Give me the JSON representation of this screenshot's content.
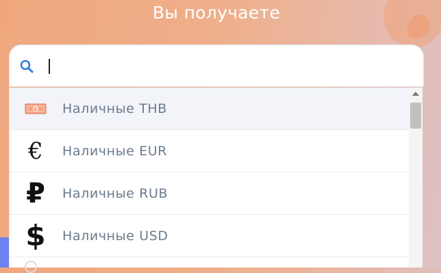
{
  "header": {
    "title": "Вы получаете"
  },
  "search": {
    "value": "",
    "placeholder": ""
  },
  "options": [
    {
      "label": "Наличные THB",
      "icon": "baht-banknote-icon",
      "glyph": "฿",
      "highlighted": true
    },
    {
      "label": "Наличные EUR",
      "icon": "euro-icon",
      "glyph": "€",
      "highlighted": false
    },
    {
      "label": "Наличные RUB",
      "icon": "ruble-icon",
      "glyph": "₽",
      "highlighted": false
    },
    {
      "label": "Наличные USD",
      "icon": "dollar-icon",
      "glyph": "$",
      "highlighted": false
    }
  ],
  "colors": {
    "title": "#ffffff",
    "option_text": "#6b7a8c",
    "highlight_bg": "#f2f4f9",
    "search_icon": "#2f7fd8",
    "baht_icon": "#f0936f"
  }
}
